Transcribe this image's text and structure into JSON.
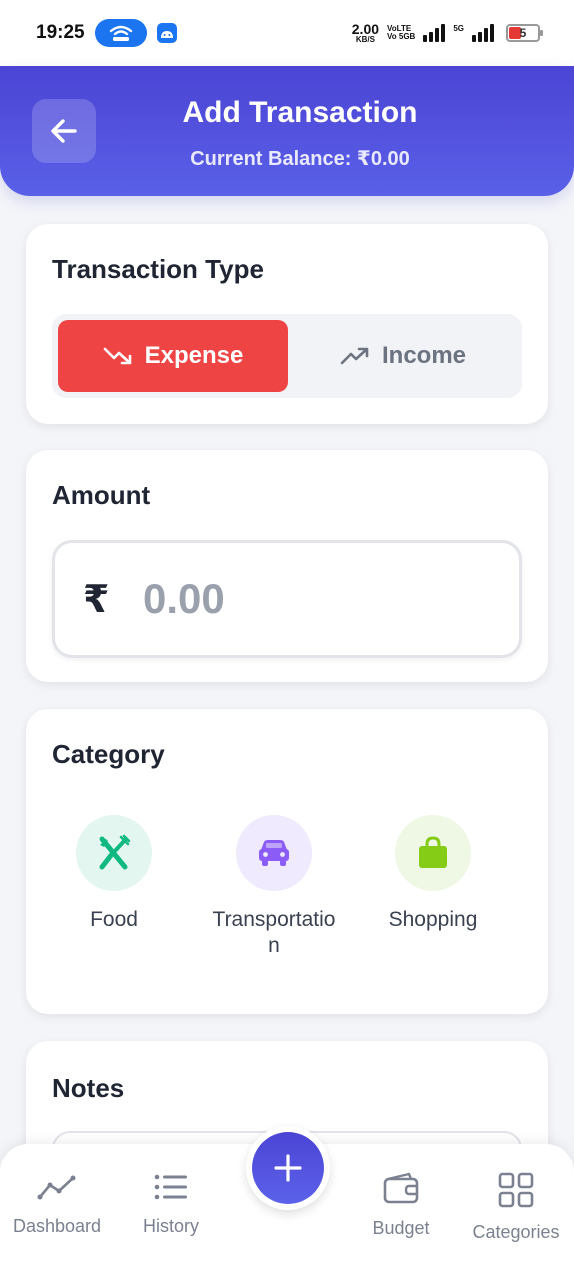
{
  "status_bar": {
    "time": "19:25",
    "net_speed_value": "2.00",
    "net_speed_unit": "KB/S",
    "volte_top": "VoLTE",
    "volte_bottom": "Vo 5GB",
    "network_label": "5G",
    "battery_level": "5"
  },
  "header": {
    "title": "Add Transaction",
    "subtitle": "Current Balance: ₹0.00"
  },
  "transaction_type": {
    "title": "Transaction Type",
    "options": [
      {
        "label": "Expense",
        "selected": true
      },
      {
        "label": "Income",
        "selected": false
      }
    ]
  },
  "amount": {
    "title": "Amount",
    "currency_symbol": "₹",
    "placeholder": "0.00",
    "value": ""
  },
  "category": {
    "title": "Category",
    "items": [
      {
        "label": "Food",
        "icon": "utensils-icon",
        "color": "#10b981",
        "bg": "#e3f6ef"
      },
      {
        "label": "Transportation",
        "icon": "car-icon",
        "color": "#8b5cf6",
        "bg": "#efeafd"
      },
      {
        "label": "Shopping",
        "icon": "shopping-bag-icon",
        "color": "#84cc16",
        "bg": "#eef8e4"
      }
    ]
  },
  "notes": {
    "title": "Notes"
  },
  "bottom_nav": {
    "items": [
      {
        "label": "Dashboard",
        "icon": "chart-line-icon"
      },
      {
        "label": "History",
        "icon": "list-icon"
      },
      {
        "label": "Budget",
        "icon": "wallet-icon"
      },
      {
        "label": "Categories",
        "icon": "grid-icon"
      }
    ],
    "fab_icon": "plus-icon"
  },
  "colors": {
    "primary": "#4f46e5",
    "expense": "#ef4444",
    "muted": "#6b7280"
  }
}
